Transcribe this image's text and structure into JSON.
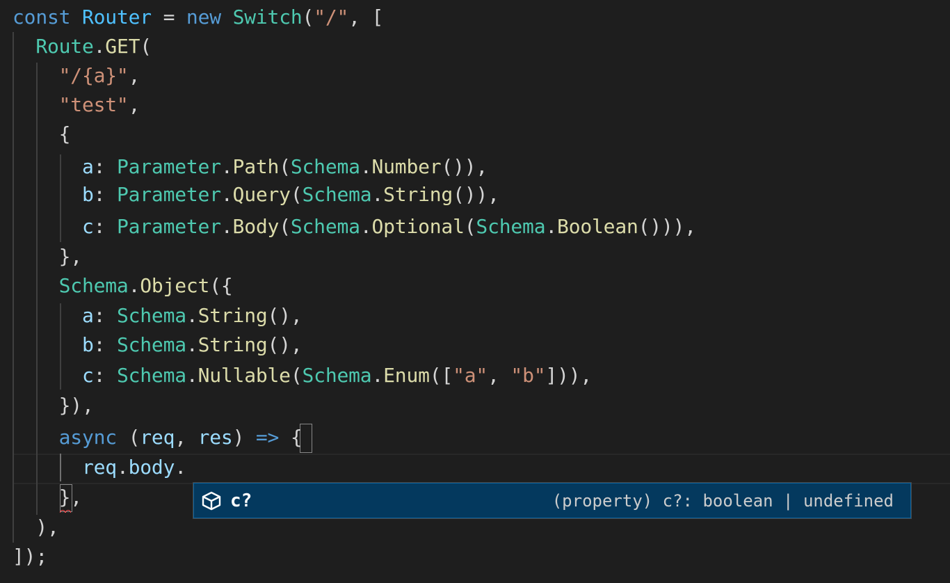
{
  "editor": {
    "lines": [
      [
        [
          "kw",
          "const"
        ],
        [
          "punc",
          " "
        ],
        [
          "var",
          "Router"
        ],
        [
          "punc",
          " = "
        ],
        [
          "kw",
          "new"
        ],
        [
          "punc",
          " "
        ],
        [
          "cls",
          "Switch"
        ],
        [
          "punc",
          "("
        ],
        [
          "str",
          "\"/\""
        ],
        [
          "punc",
          ", ["
        ]
      ],
      [
        [
          "punc",
          "  "
        ],
        [
          "cls",
          "Route"
        ],
        [
          "punc",
          "."
        ],
        [
          "fn",
          "GET"
        ],
        [
          "punc",
          "("
        ]
      ],
      [
        [
          "punc",
          "    "
        ],
        [
          "str",
          "\"/{a}\""
        ],
        [
          "punc",
          ","
        ]
      ],
      [
        [
          "punc",
          "    "
        ],
        [
          "str",
          "\"test\""
        ],
        [
          "punc",
          ","
        ]
      ],
      [
        [
          "punc",
          "    {"
        ]
      ],
      [
        [
          "punc",
          "      "
        ],
        [
          "prop",
          "a"
        ],
        [
          "punc",
          ": "
        ],
        [
          "cls",
          "Parameter"
        ],
        [
          "punc",
          "."
        ],
        [
          "fn",
          "Path"
        ],
        [
          "punc",
          "("
        ],
        [
          "cls",
          "Schema"
        ],
        [
          "punc",
          "."
        ],
        [
          "fn",
          "Number"
        ],
        [
          "punc",
          "()),"
        ]
      ],
      [
        [
          "punc",
          "      "
        ],
        [
          "prop",
          "b"
        ],
        [
          "punc",
          ": "
        ],
        [
          "cls",
          "Parameter"
        ],
        [
          "punc",
          "."
        ],
        [
          "fn",
          "Query"
        ],
        [
          "punc",
          "("
        ],
        [
          "cls",
          "Schema"
        ],
        [
          "punc",
          "."
        ],
        [
          "fn",
          "String"
        ],
        [
          "punc",
          "()),"
        ]
      ],
      [
        [
          "punc",
          "      "
        ],
        [
          "prop",
          "c"
        ],
        [
          "punc",
          ": "
        ],
        [
          "cls",
          "Parameter"
        ],
        [
          "punc",
          "."
        ],
        [
          "fn",
          "Body"
        ],
        [
          "punc",
          "("
        ],
        [
          "cls",
          "Schema"
        ],
        [
          "punc",
          "."
        ],
        [
          "fn",
          "Optional"
        ],
        [
          "punc",
          "("
        ],
        [
          "cls",
          "Schema"
        ],
        [
          "punc",
          "."
        ],
        [
          "fn",
          "Boolean"
        ],
        [
          "punc",
          "())),"
        ]
      ],
      [
        [
          "punc",
          "    },"
        ]
      ],
      [
        [
          "punc",
          "    "
        ],
        [
          "cls",
          "Schema"
        ],
        [
          "punc",
          "."
        ],
        [
          "fn",
          "Object"
        ],
        [
          "punc",
          "({"
        ]
      ],
      [
        [
          "punc",
          "      "
        ],
        [
          "prop",
          "a"
        ],
        [
          "punc",
          ": "
        ],
        [
          "cls",
          "Schema"
        ],
        [
          "punc",
          "."
        ],
        [
          "fn",
          "String"
        ],
        [
          "punc",
          "(),"
        ]
      ],
      [
        [
          "punc",
          "      "
        ],
        [
          "prop",
          "b"
        ],
        [
          "punc",
          ": "
        ],
        [
          "cls",
          "Schema"
        ],
        [
          "punc",
          "."
        ],
        [
          "fn",
          "String"
        ],
        [
          "punc",
          "(),"
        ]
      ],
      [
        [
          "punc",
          "      "
        ],
        [
          "prop",
          "c"
        ],
        [
          "punc",
          ": "
        ],
        [
          "cls",
          "Schema"
        ],
        [
          "punc",
          "."
        ],
        [
          "fn",
          "Nullable"
        ],
        [
          "punc",
          "("
        ],
        [
          "cls",
          "Schema"
        ],
        [
          "punc",
          "."
        ],
        [
          "fn",
          "Enum"
        ],
        [
          "punc",
          "(["
        ],
        [
          "str",
          "\"a\""
        ],
        [
          "punc",
          ", "
        ],
        [
          "str",
          "\"b\""
        ],
        [
          "punc",
          "])),"
        ]
      ],
      [
        [
          "punc",
          "    }),"
        ]
      ],
      [
        [
          "punc",
          "    "
        ],
        [
          "kw",
          "async"
        ],
        [
          "punc",
          " ("
        ],
        [
          "prop",
          "req"
        ],
        [
          "punc",
          ", "
        ],
        [
          "prop",
          "res"
        ],
        [
          "punc",
          ") "
        ],
        [
          "kw",
          "=>"
        ],
        [
          "punc",
          " {"
        ]
      ],
      [
        [
          "punc",
          "      "
        ],
        [
          "prop",
          "req"
        ],
        [
          "punc",
          "."
        ],
        [
          "prop",
          "body"
        ],
        [
          "punc",
          "."
        ]
      ],
      [
        [
          "punc",
          "    },"
        ]
      ],
      [
        [
          "punc",
          "  ),"
        ]
      ],
      [
        [
          "punc",
          "]);"
        ]
      ]
    ]
  },
  "suggest": {
    "icon": "property-cube-icon",
    "label": "c?",
    "detail": "(property) c?: boolean | undefined"
  },
  "colors": {
    "keyword": "#569cd6",
    "class": "#4ec9b0",
    "variable": "#4fc1ff",
    "string": "#ce9178",
    "function": "#dcdcaa",
    "property": "#9cdcfe",
    "punctuation": "#d4d4d4",
    "background": "#1e1e1e",
    "suggest_selected": "#04395e"
  }
}
